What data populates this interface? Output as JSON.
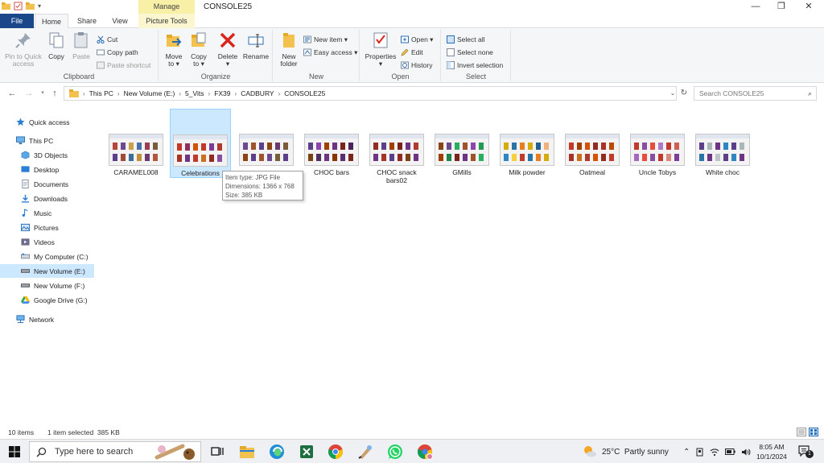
{
  "titlebar": {
    "manage": "Manage",
    "title": "CONSOLE25",
    "minimize": "—",
    "maximize": "❐",
    "close": "✕"
  },
  "tabs": {
    "file": "File",
    "home": "Home",
    "share": "Share",
    "view": "View",
    "picture_tools": "Picture Tools"
  },
  "ribbon": {
    "clipboard": {
      "label": "Clipboard",
      "pin_line1": "Pin to Quick",
      "pin_line2": "access",
      "copy": "Copy",
      "paste": "Paste",
      "cut": "Cut",
      "copy_path": "Copy path",
      "paste_shortcut": "Paste shortcut"
    },
    "organize": {
      "label": "Organize",
      "move_line1": "Move",
      "move_line2": "to ▾",
      "copy_line1": "Copy",
      "copy_line2": "to ▾",
      "delete_line1": "Delete",
      "delete_line2": "▾",
      "rename": "Rename"
    },
    "new": {
      "label": "New",
      "new_folder_line1": "New",
      "new_folder_line2": "folder",
      "new_item": "New item ▾",
      "easy_access": "Easy access ▾"
    },
    "open": {
      "label": "Open",
      "properties_line1": "Properties",
      "properties_line2": "▾",
      "open": "Open ▾",
      "edit": "Edit",
      "history": "History"
    },
    "select": {
      "label": "Select",
      "select_all": "Select all",
      "select_none": "Select none",
      "invert_selection": "Invert selection"
    }
  },
  "address": {
    "crumbs": [
      "This PC",
      "New Volume (E:)",
      "5_Vits",
      "FX39",
      "CADBURY",
      "CONSOLE25"
    ],
    "separator": "›",
    "search_placeholder": "Search CONSOLE25"
  },
  "navpane": {
    "items": [
      {
        "label": "Quick access"
      },
      {
        "label": "This PC"
      },
      {
        "label": "3D Objects"
      },
      {
        "label": "Desktop"
      },
      {
        "label": "Documents"
      },
      {
        "label": "Downloads"
      },
      {
        "label": "Music"
      },
      {
        "label": "Pictures"
      },
      {
        "label": "Videos"
      },
      {
        "label": "My Computer (C:)"
      },
      {
        "label": "New Volume (E:)"
      },
      {
        "label": "New Volume (F:)"
      },
      {
        "label": "Google Drive (G:)"
      },
      {
        "label": "Network"
      }
    ]
  },
  "files": [
    {
      "line1": "CARAMEL008",
      "line2": ""
    },
    {
      "line1": "Celebrations",
      "line2": ""
    },
    {
      "line1": "",
      "line2": ""
    },
    {
      "line1": "CHOC bars",
      "line2": ""
    },
    {
      "line1": "CHOC snack",
      "line2": "bars02"
    },
    {
      "line1": "GMills",
      "line2": ""
    },
    {
      "line1": "Milk powder",
      "line2": ""
    },
    {
      "line1": "Oatmeal",
      "line2": ""
    },
    {
      "line1": "Uncle Tobys",
      "line2": ""
    },
    {
      "line1": "White choc",
      "line2": ""
    }
  ],
  "tooltip": {
    "type": "Item type: JPG File",
    "dimensions": "Dimensions: 1366 x 768",
    "size": "Size: 385 KB"
  },
  "status": {
    "count": "10 items",
    "selected": "1 item selected  385 KB"
  },
  "taskbar": {
    "search_placeholder": "Type here to search",
    "weather": "25°C  Partly sunny",
    "time": "8:05 AM",
    "date": "10/1/2024",
    "notification_count": "1"
  },
  "colors": {
    "file_tab": "#19478a",
    "selection": "#cce8ff",
    "manage_tab": "#f8f0a6",
    "accent": "#0067c0"
  }
}
